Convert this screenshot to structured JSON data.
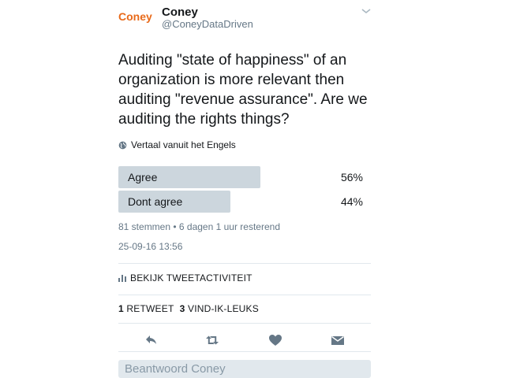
{
  "header": {
    "logo_text": "Coney",
    "display_name": "Coney",
    "handle": "@ConeyDataDriven"
  },
  "tweet": {
    "text": "Auditing \"state of happiness\" of an organization is more relevant then auditing \"revenue assurance\". Are we auditing the rights things?",
    "translate_label": "Vertaal vanuit het Engels"
  },
  "poll": {
    "options": [
      {
        "label": "Agree",
        "percent_text": "56%",
        "fraction": 0.56
      },
      {
        "label": "Dont agree",
        "percent_text": "44%",
        "fraction": 0.44
      }
    ],
    "meta": "81 stemmen • 6 dagen 1 uur resterend"
  },
  "timestamp": "25-09-16 13:56",
  "activity_label": "BEKIJK TWEETACTIVITEIT",
  "stats": {
    "retweet_count": "1",
    "retweet_label": "RETWEET",
    "like_count": "3",
    "like_label": "VIND-IK-LEUKS"
  },
  "reply_placeholder": "Beantwoord Coney",
  "colors": {
    "poll_bar": "#ccd6dd",
    "icon": "#657786",
    "brand": "#e86a1a"
  }
}
